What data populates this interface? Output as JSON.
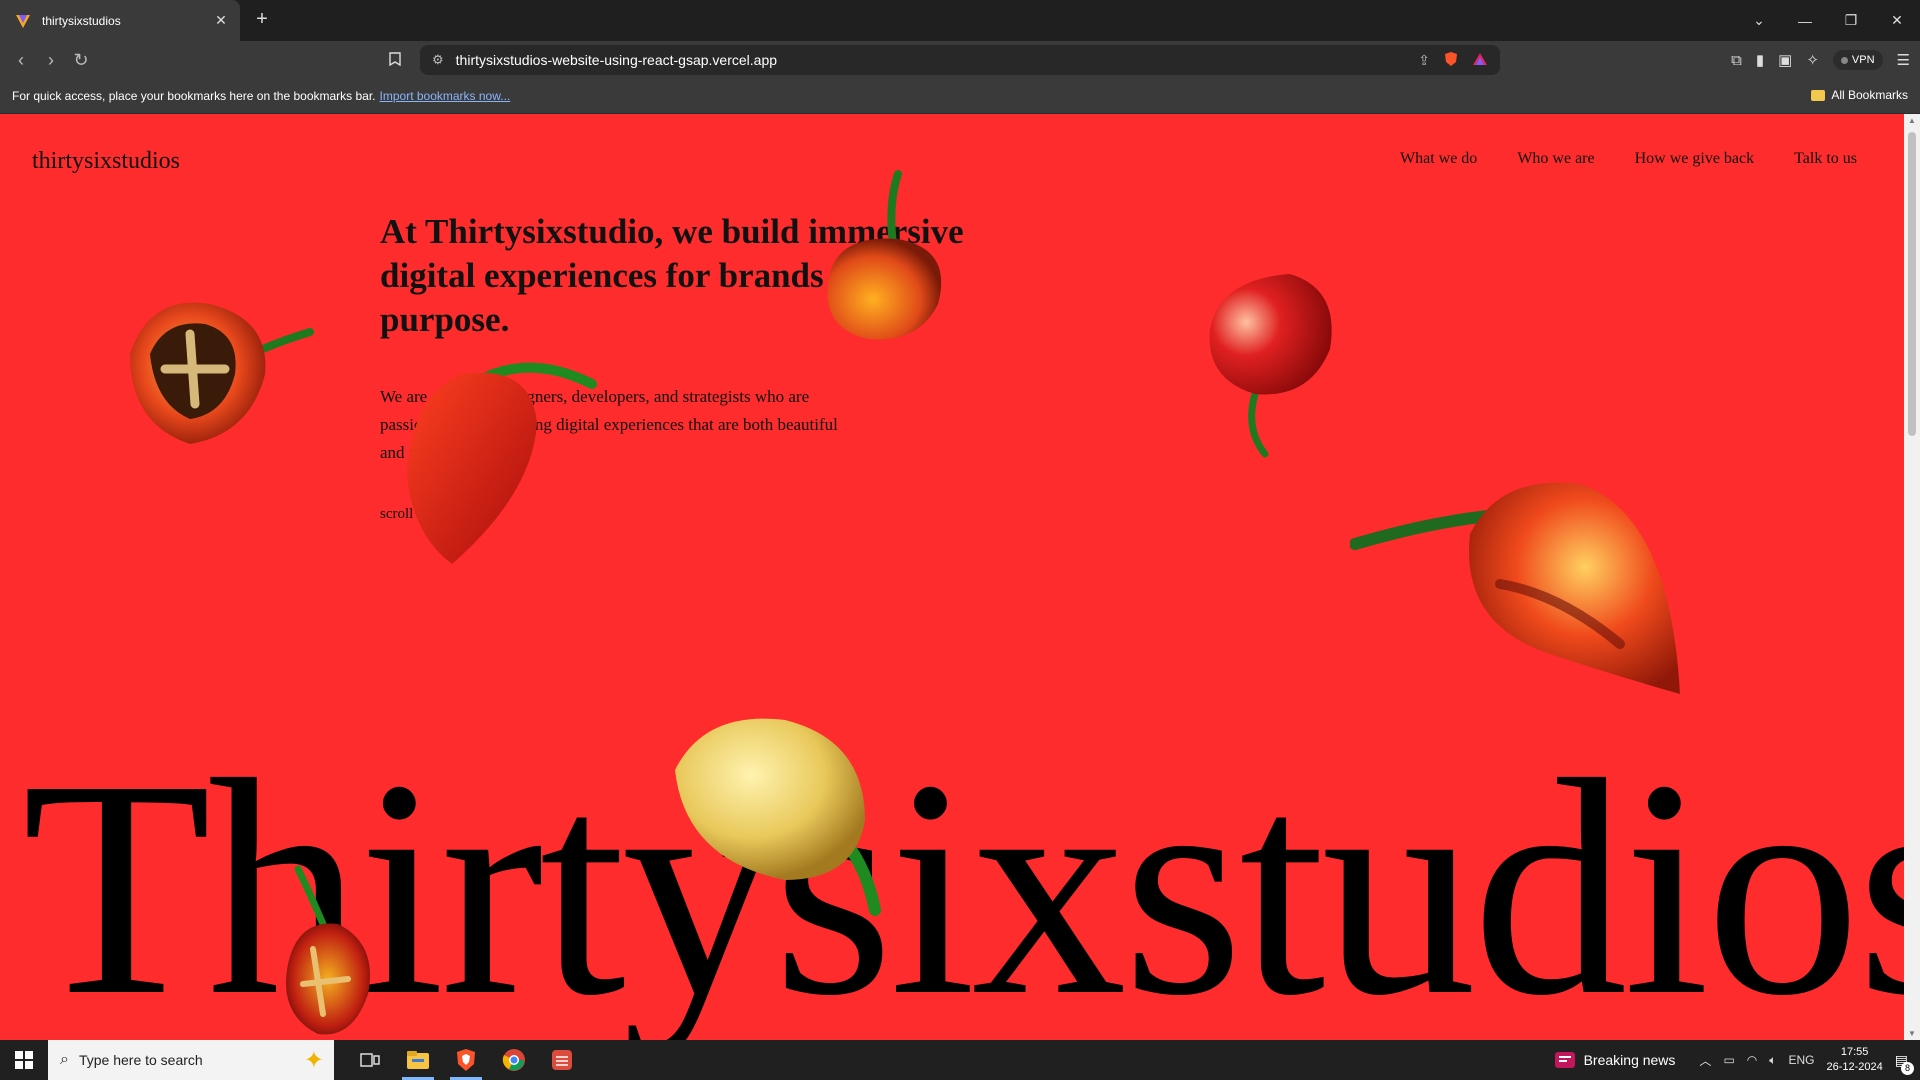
{
  "browser": {
    "tab_title": "thirtysixstudios",
    "new_tab": "+",
    "url": "thirtysixstudios-website-using-react-gsap.vercel.app",
    "vpn_label": "VPN",
    "bookmarks_message": "For quick access, place your bookmarks here on the bookmarks bar.",
    "bookmarks_link": "Import bookmarks now...",
    "all_bookmarks": "All Bookmarks"
  },
  "site": {
    "logo": "thirtysixstudios",
    "nav": [
      "What we do",
      "Who we are",
      "How we give back",
      "Talk to us"
    ],
    "headline": "At Thirtysixstudio, we build immersive digital experiences for brands with a purpose.",
    "subtext": "We are a team of designers, developers, and strategists who are passionate about creating digital experiences that are both beautiful and functional.",
    "scroll_cue": "scroll",
    "big_word": "Thirtysixstudios",
    "bg_color": "#fe2c2c"
  },
  "taskbar": {
    "search_placeholder": "Type here to search",
    "news": "Breaking news",
    "lang": "ENG",
    "time": "17:55",
    "date": "26-12-2024",
    "notifications": "8"
  }
}
